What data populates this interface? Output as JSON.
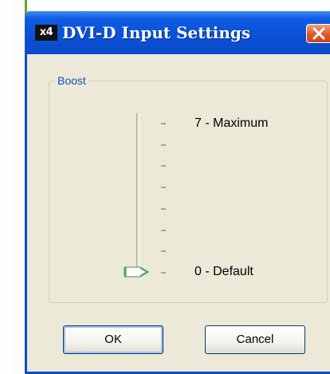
{
  "window": {
    "icon_text": "x4",
    "title": "DVI-D Input Settings",
    "close_icon": "close-x-icon"
  },
  "group": {
    "label": "Boost"
  },
  "slider": {
    "min_label": "0 - Default",
    "max_label": "7 - Maximum",
    "min": 0,
    "max": 7,
    "value": 0,
    "tick_count": 8
  },
  "buttons": {
    "ok": "OK",
    "cancel": "Cancel"
  },
  "colors": {
    "title_bar": "#0a52d8",
    "client_bg": "#ece9d8",
    "group_label": "#1a4fbf",
    "close_button": "#e0572a",
    "thumb_accent": "#3fae3c"
  }
}
